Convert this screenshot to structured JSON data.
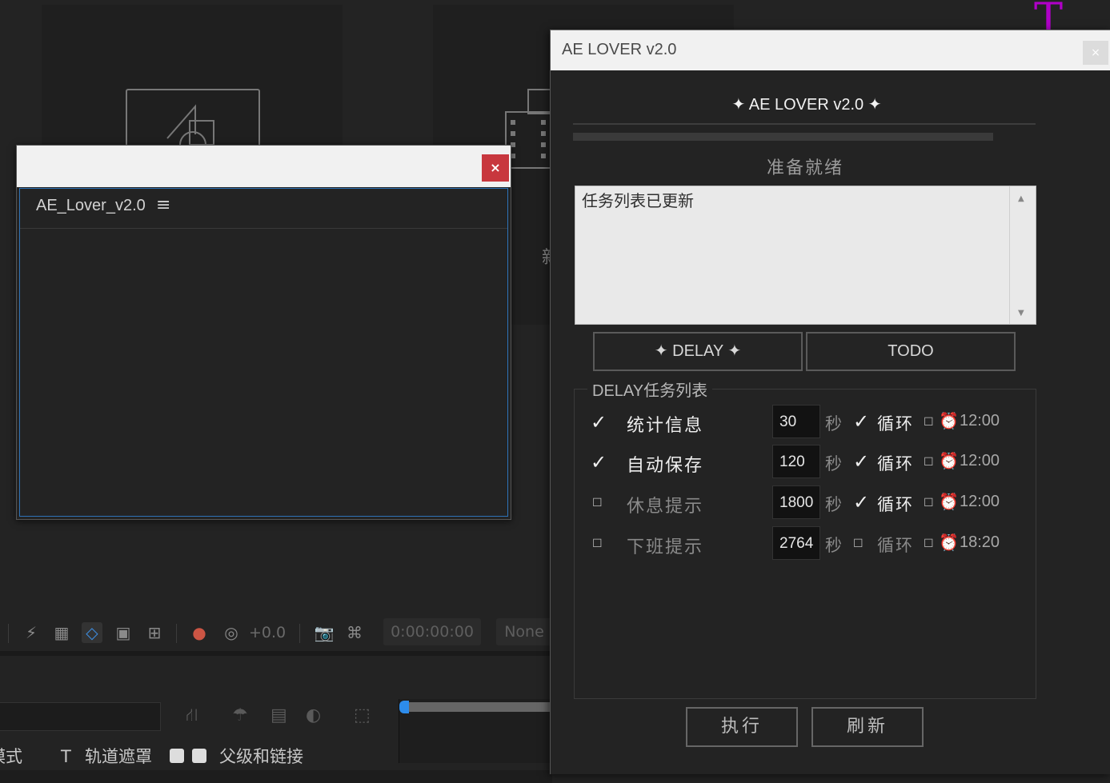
{
  "colors": {
    "accent_blue": "#2e73b8",
    "close_red": "#c8373e",
    "magenta": "#b000c8"
  },
  "background": {
    "partial_glyph": "新",
    "toolbar": {
      "exposure": "+0.0",
      "timecode": "0:00:00:00",
      "view": "None"
    },
    "timeline": {
      "mode_col": "模式",
      "t_col": "T",
      "track_matte": "轨道遮罩",
      "parent": "父级和链接"
    },
    "right_edge_glyph": "T"
  },
  "left_panel": {
    "close_label": "×",
    "tab_label": "AE_Lover_v2.0",
    "menu_icon": "≡"
  },
  "dialog": {
    "title": "AE LOVER v2.0",
    "close_label": "×",
    "header": "AE LOVER v2.0",
    "sparkle": "✦",
    "status": "准备就绪",
    "log_text": "任务列表已更新",
    "tabs": {
      "delay": "DELAY",
      "todo": "TODO"
    },
    "group_label": "DELAY任务列表",
    "seconds_unit": "秒",
    "loop_label": "循环",
    "tasks": [
      {
        "name": "统计信息",
        "enabled": true,
        "seconds": "30",
        "loop": true,
        "time": "12:00"
      },
      {
        "name": "自动保存",
        "enabled": true,
        "seconds": "120",
        "loop": true,
        "time": "12:00"
      },
      {
        "name": "休息提示",
        "enabled": false,
        "seconds": "1800",
        "loop": true,
        "time": "12:00"
      },
      {
        "name": "下班提示",
        "enabled": false,
        "seconds": "2764",
        "loop": false,
        "time": "18:20"
      }
    ],
    "buttons": {
      "execute": "执行",
      "refresh": "刷新"
    }
  }
}
